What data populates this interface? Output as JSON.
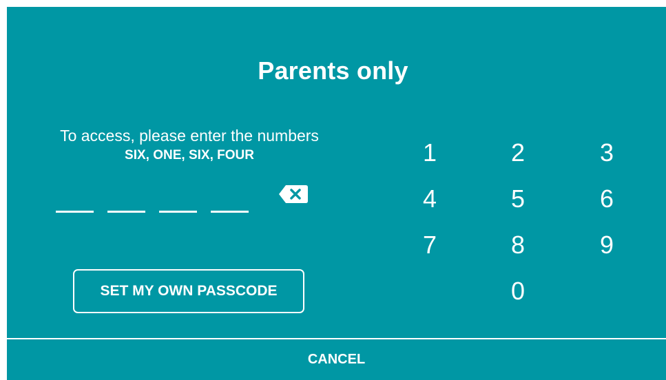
{
  "dialog": {
    "title": "Parents only",
    "instruction": "To access, please enter the numbers",
    "code_words": "SIX, ONE, SIX, FOUR",
    "slot_count": 4,
    "set_passcode_label": "SET MY OWN PASSCODE",
    "cancel_label": "CANCEL"
  },
  "keypad": {
    "keys": [
      "1",
      "2",
      "3",
      "4",
      "5",
      "6",
      "7",
      "8",
      "9",
      "0"
    ]
  },
  "colors": {
    "background": "#0097a4",
    "foreground": "#ffffff"
  }
}
